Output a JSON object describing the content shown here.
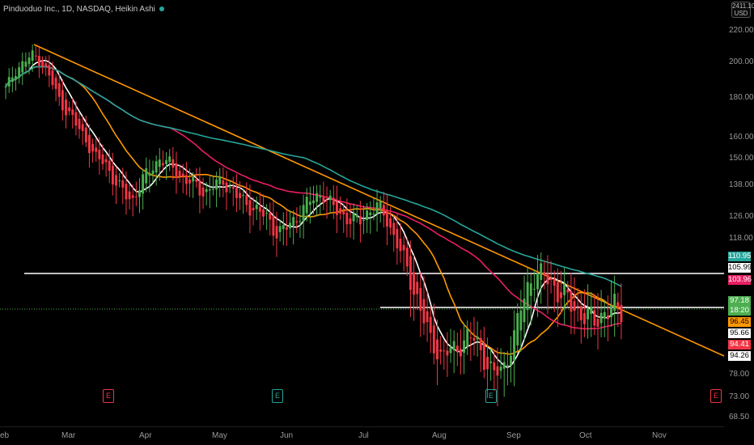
{
  "header": {
    "title": "Pinduoduo Inc., 1D, NASDAQ, Heikin Ashi"
  },
  "currency_button": {
    "top": "2411.10",
    "bottom": "USD"
  },
  "axis": {
    "y_ticks": [
      "220.00",
      "200.00",
      "180.00",
      "160.00",
      "150.00",
      "138.00",
      "126.00",
      "118.00",
      "78.00",
      "73.00",
      "68.50"
    ],
    "x_ticks": [
      "eb",
      "Mar",
      "Apr",
      "May",
      "Jun",
      "Jul",
      "Aug",
      "Sep",
      "Oct",
      "Nov"
    ]
  },
  "price_tags": [
    {
      "label": "110.95",
      "bg": "#26a69a",
      "fg": "#ffffff"
    },
    {
      "label": "105.99",
      "bg": "#ffffff",
      "fg": "#000000"
    },
    {
      "label": "103.96",
      "bg": "#e91e63",
      "fg": "#ffffff"
    },
    {
      "label": "97.18",
      "bg": "#4caf50",
      "fg": "#ffffff"
    },
    {
      "label": "18:20",
      "bg": "#4caf50",
      "fg": "#ffffff"
    },
    {
      "label": "96.45",
      "bg": "#ff9800",
      "fg": "#000000"
    },
    {
      "label": "95.66",
      "bg": "#ffffff",
      "fg": "#000000"
    },
    {
      "label": "94.41",
      "bg": "#f23645",
      "fg": "#ffffff"
    },
    {
      "label": "94.26",
      "bg": "#ffffff",
      "fg": "#000000"
    }
  ],
  "earnings_badges": [
    {
      "label": "E",
      "color": "#f23645"
    },
    {
      "label": "E",
      "color": "#26a69a"
    },
    {
      "label": "E",
      "color": "#26a69a"
    },
    {
      "label": "E",
      "color": "#f23645"
    }
  ],
  "chart_data": {
    "type": "candlestick",
    "symbol": "Pinduoduo Inc.",
    "interval": "1D",
    "exchange": "NASDAQ",
    "style": "Heikin Ashi",
    "months": [
      "Feb",
      "Mar",
      "Apr",
      "May",
      "Jun",
      "Jul",
      "Aug",
      "Sep",
      "Oct",
      "Nov"
    ],
    "y_axis_values": [
      220,
      200,
      180,
      160,
      150,
      138,
      126,
      118,
      78,
      73,
      68.5
    ],
    "close_approx": [
      185,
      195,
      200,
      205,
      200,
      190,
      178,
      172,
      165,
      158,
      150,
      148,
      140,
      135,
      132,
      140,
      145,
      150,
      148,
      143,
      140,
      138,
      135,
      138,
      140,
      136,
      132,
      130,
      128,
      125,
      120,
      122,
      125,
      130,
      133,
      135,
      130,
      127,
      125,
      124,
      128,
      130,
      126,
      118,
      110,
      102,
      96,
      88,
      84,
      85,
      86,
      90,
      88,
      82,
      78,
      80,
      88,
      98,
      104,
      106,
      104,
      101,
      99,
      97,
      95,
      94,
      96,
      97,
      97
    ],
    "levels": {
      "horizontal_1": 105.99,
      "horizontal_2": 97.18,
      "current_price": 97.18
    },
    "moving_averages": [
      {
        "color": "#ffffff",
        "last": 95.66
      },
      {
        "color": "#ff9800",
        "last": 96.45
      },
      {
        "color": "#e91e63",
        "last": 103.96
      },
      {
        "color": "#26a69a",
        "last": 110.95
      }
    ],
    "trendline": {
      "color": "#ff9800"
    }
  }
}
